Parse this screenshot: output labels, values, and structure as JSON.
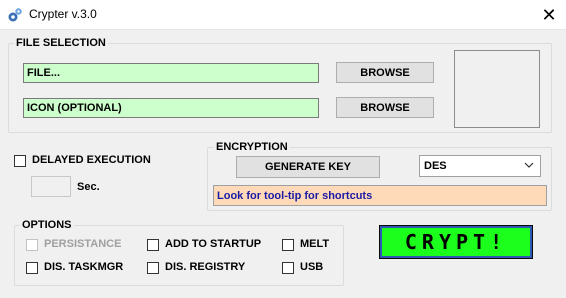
{
  "window": {
    "title": "Crypter v.3.0",
    "close_glyph": "✕",
    "icon": "app-gear-icon"
  },
  "file_selection": {
    "label": "FILE SELECTION",
    "file_field": "FILE...",
    "icon_field": "ICON (OPTIONAL)",
    "browse_label": "BROWSE",
    "field_color": "#ccffcc"
  },
  "delayed": {
    "label": "DELAYED EXECUTION",
    "checked": false,
    "value": "",
    "unit": "Sec."
  },
  "encryption": {
    "label": "ENCRYPTION",
    "generate_label": "GENERATE KEY",
    "algorithm": "DES",
    "hint": "Look for tool-tip for shortcuts",
    "hint_bg": "#ffdab9"
  },
  "options": {
    "label": "OPTIONS",
    "items": [
      {
        "label": "PERSISTANCE",
        "checked": false,
        "enabled": false
      },
      {
        "label": "ADD TO STARTUP",
        "checked": false,
        "enabled": true
      },
      {
        "label": "MELT",
        "checked": false,
        "enabled": true
      },
      {
        "label": "DIS. TASKMGR",
        "checked": false,
        "enabled": true
      },
      {
        "label": "DIS. REGISTRY",
        "checked": false,
        "enabled": true
      },
      {
        "label": "USB",
        "checked": false,
        "enabled": true
      }
    ]
  },
  "crypt": {
    "label": "CRYPT!",
    "color": "#1cff1c"
  }
}
